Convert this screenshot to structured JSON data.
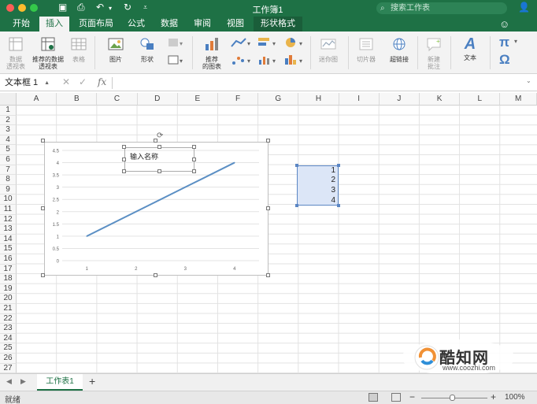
{
  "titlebar": {
    "title": "工作簿1",
    "search_placeholder": "搜索工作表",
    "quick_access": [
      "home-icon",
      "save-icon",
      "undo-icon",
      "redo-icon",
      "customize-icon"
    ]
  },
  "tabs": [
    {
      "label": "开始"
    },
    {
      "label": "插入"
    },
    {
      "label": "页面布局"
    },
    {
      "label": "公式"
    },
    {
      "label": "数据"
    },
    {
      "label": "审阅"
    },
    {
      "label": "视图"
    },
    {
      "label": "形状格式"
    }
  ],
  "ribbon": {
    "pivot_table": "数据\n透视表",
    "recommended_pivot": "推荐的数据\n透视表",
    "table": "表格",
    "picture": "图片",
    "shapes": "形状",
    "recommended_charts": "推荐\n的图表",
    "sparklines": "迷你图",
    "slicer": "切片器",
    "hyperlink": "超链接",
    "new_comment": "新建\n批注",
    "text": "文本",
    "pi_symbol": "π",
    "omega_symbol": "Ω"
  },
  "formula_bar": {
    "name_box": "文本框 1",
    "cancel": "✕",
    "enter": "✓",
    "fx": "fx",
    "formula": ""
  },
  "columns": [
    "A",
    "B",
    "C",
    "D",
    "E",
    "F",
    "G",
    "H",
    "I",
    "J",
    "K",
    "L",
    "M"
  ],
  "rows": [
    "1",
    "2",
    "3",
    "4",
    "5",
    "6",
    "7",
    "8",
    "9",
    "10",
    "11",
    "12",
    "13",
    "14",
    "15",
    "16",
    "17",
    "18",
    "19",
    "20",
    "21",
    "22",
    "23",
    "24",
    "25",
    "26",
    "27"
  ],
  "cells": {
    "H7": "1",
    "H8": "2",
    "H9": "3",
    "H10": "4"
  },
  "chart": {
    "textbox": "输入名称"
  },
  "chart_data": {
    "type": "line",
    "categories": [
      "1",
      "2",
      "3",
      "4"
    ],
    "series": [
      {
        "values": [
          1,
          2,
          3,
          4
        ],
        "color": "#5b8fc4"
      }
    ],
    "ylim": [
      0,
      4.5
    ],
    "yticks": [
      "0",
      "0.5",
      "1",
      "1.5",
      "2",
      "2.5",
      "3",
      "3.5",
      "4",
      "4.5"
    ],
    "grid": true,
    "title": "",
    "xlabel": "",
    "ylabel": ""
  },
  "sheet_tabs": {
    "active": "工作表1",
    "add": "+"
  },
  "status": {
    "ready": "就绪",
    "zoom": "100%",
    "zoom_minus": "−",
    "zoom_plus": "+"
  },
  "watermark": {
    "name": "酷知网",
    "url": "www.coozhi.com"
  },
  "colors": {
    "brand": "#1e7145",
    "selection": "#5b86c4",
    "series": "#5b8fc4"
  }
}
